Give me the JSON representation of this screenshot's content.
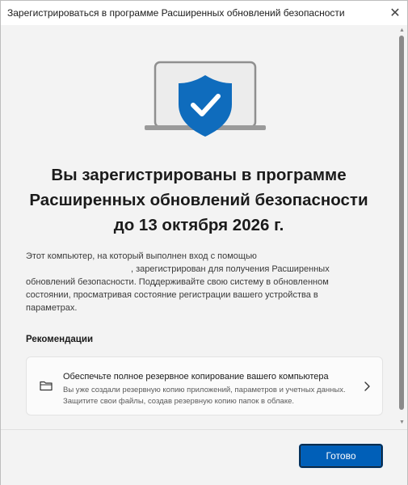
{
  "window": {
    "title": "Зарегистрироваться в программе Расширенных обновлений безопасности",
    "close_glyph": "✕"
  },
  "hero": {
    "icon": "laptop-shield-check-icon",
    "accent": "#0f6cbd"
  },
  "headline": "Вы зарегистрированы в программе Расширенных обновлений безопасности до 13 октября 2026 г.",
  "body": {
    "part1": "Этот компьютер, на который выполнен вход с помощью",
    "part2": ", зарегистрирован для получения Расширенных обновлений безопасности. Поддерживайте свою систему в обновленном состоянии, просматривая состояние регистрации вашего устройства в параметрах."
  },
  "recommendations": {
    "heading": "Рекомендации",
    "items": [
      {
        "icon": "folder-icon",
        "title": "Обеспечьте полное резервное копирование вашего компьютера",
        "description": "Вы уже создали резервную копию приложений, параметров и учетных данных. Защитите свои файлы, создав резервную копию папок в облаке."
      }
    ]
  },
  "footer": {
    "done_label": "Готово"
  },
  "scrollbar": {
    "up_glyph": "▲",
    "down_glyph": "▼"
  }
}
